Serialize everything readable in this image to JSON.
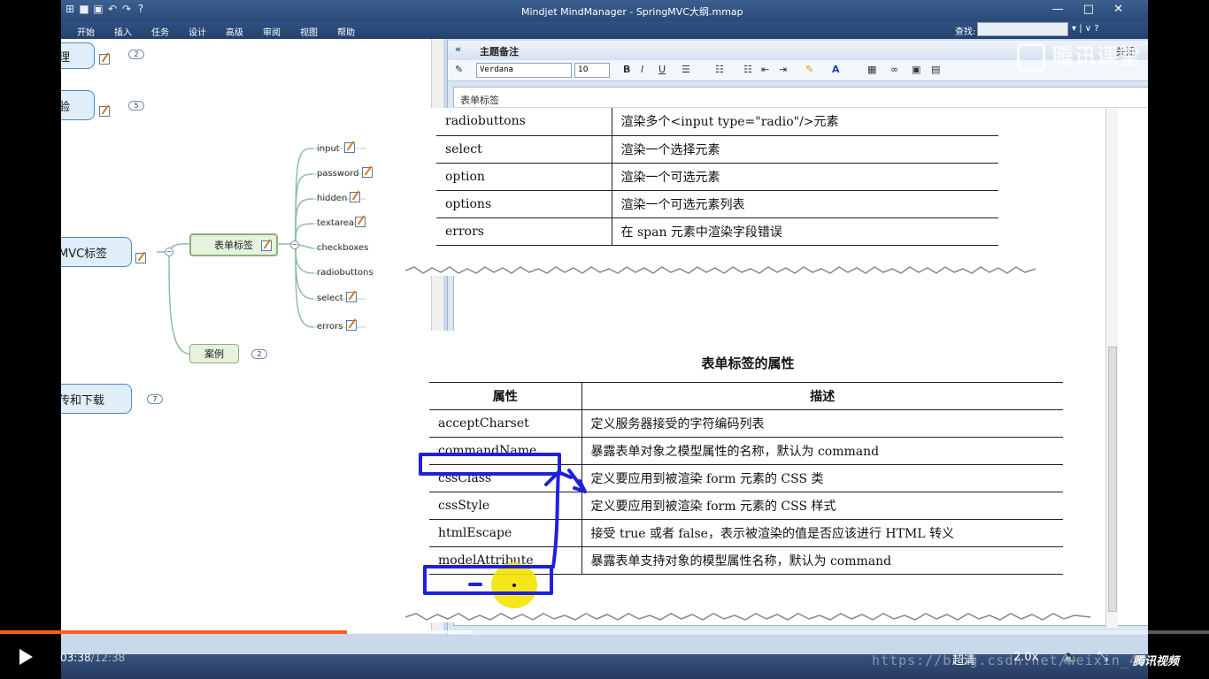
{
  "window": {
    "title": "Mindjet MindManager - SpringMVC大纲.mmap",
    "minimize": "—",
    "maximize": "□",
    "close": "✕"
  },
  "ribbon": {
    "tabs": [
      "开始",
      "插入",
      "任务",
      "设计",
      "高级",
      "审阅",
      "视图",
      "帮助"
    ],
    "find_label": "查找:",
    "extra": "▾ | ∨ ?"
  },
  "mindmap": {
    "topics": [
      {
        "label": "理",
        "count": "2"
      },
      {
        "label": "验",
        "count": "5"
      },
      {
        "label": "MVC标签"
      },
      {
        "label": "传和下载",
        "count": "7"
      }
    ],
    "subtopics": [
      {
        "label": "表单标签"
      },
      {
        "label": "案例",
        "count": "2"
      }
    ],
    "leaves": [
      "input",
      "password",
      "hidden",
      "textarea",
      "checkboxes",
      "radiobuttons",
      "select",
      "errors"
    ]
  },
  "notes": {
    "header_title": "主题备注",
    "close_label": "关闭",
    "font_name": "Verdana",
    "font_size": "10",
    "doc_title": "表单标签"
  },
  "scan1": {
    "rows": [
      {
        "k": "radiobuttons",
        "v": "渲染多个<input type=\"radio\"/>元素"
      },
      {
        "k": "select",
        "v": "渲染一个选择元素"
      },
      {
        "k": "option",
        "v": "渲染一个可选元素"
      },
      {
        "k": "options",
        "v": "渲染一个可选元素列表"
      },
      {
        "k": "errors",
        "v": "在 span 元素中渲染字段错误"
      }
    ]
  },
  "scan2": {
    "caption": "表单标签的属性",
    "head_k": "属性",
    "head_v": "描述",
    "rows": [
      {
        "k": "acceptCharset",
        "v": "定义服务器接受的字符编码列表"
      },
      {
        "k": "commandName",
        "v": "暴露表单对象之模型属性的名称，默认为 command"
      },
      {
        "k": "cssClass",
        "v": "定义要应用到被渲染 form 元素的 CSS 类"
      },
      {
        "k": "cssStyle",
        "v": "定义要应用到被渲染 form 元素的 CSS 样式"
      },
      {
        "k": "htmlEscape",
        "v": "接受 true 或者 false，表示被渲染的值是否应该进行 HTML 转义"
      },
      {
        "k": "modelAttribute",
        "v": "暴露表单支持对象的模型属性名称，默认为 command"
      }
    ]
  },
  "overlay": {
    "watermark": "腾讯课堂",
    "url_watermark": "https://blog.csdn.net/weixin_45"
  },
  "player": {
    "current_time": "03:38",
    "total_time": "/12:38",
    "progress": 0.287,
    "buffered": 0.39,
    "quality": "超清",
    "speed": "2.0x",
    "brand": "腾讯视频"
  },
  "colors": {
    "annotation": "#1f1fe0",
    "highlight": "#f4e300",
    "progress": "#ff5a1f"
  }
}
